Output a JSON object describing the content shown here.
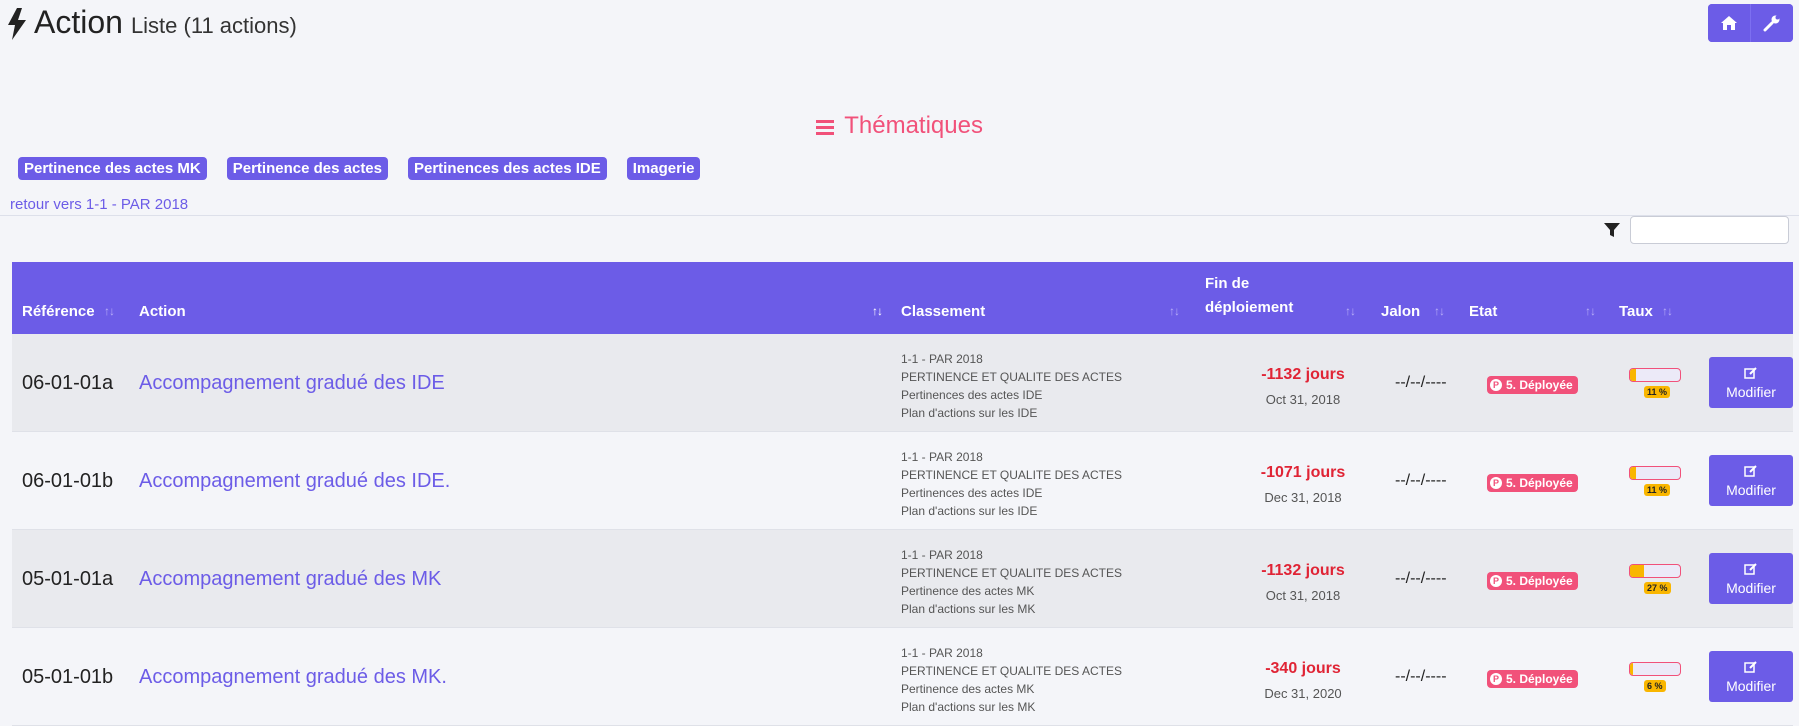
{
  "header": {
    "title": "Action",
    "subtitle": "Liste (11 actions)",
    "icon": "bolt-icon"
  },
  "toolbar": {
    "home_icon": "home-icon",
    "settings_icon": "wrench-icon"
  },
  "thematiques": {
    "title": "Thématiques",
    "tags": [
      "Pertinence des actes MK",
      "Pertinence des actes",
      "Pertinences des actes IDE",
      "Imagerie"
    ]
  },
  "back_link": "retour vers 1-1 - PAR 2018",
  "search": {
    "value": "",
    "placeholder": ""
  },
  "table": {
    "columns": {
      "reference": "Référence",
      "action": "Action",
      "classement": "Classement",
      "fin_line1": "Fin de",
      "fin_line2": "déploiement",
      "jalon": "Jalon",
      "etat": "Etat",
      "taux": "Taux"
    },
    "edit_label": "Modifier",
    "rows": [
      {
        "ref": "06-01-01a",
        "action": "Accompagnement gradué des IDE",
        "classement": [
          "1-1 - PAR 2018",
          "PERTINENCE ET QUALITE DES ACTES",
          "Pertinences des actes IDE",
          "Plan d'actions sur les IDE"
        ],
        "days": "-1132 jours",
        "date": "Oct 31, 2018",
        "jalon": "--/--/----",
        "etat": "5. Déployée",
        "taux": 11,
        "taux_label": "11 %"
      },
      {
        "ref": "06-01-01b",
        "action": "Accompagnement gradué des IDE.",
        "classement": [
          "1-1 - PAR 2018",
          "PERTINENCE ET QUALITE DES ACTES",
          "Pertinences des actes IDE",
          "Plan d'actions sur les IDE"
        ],
        "days": "-1071 jours",
        "date": "Dec 31, 2018",
        "jalon": "--/--/----",
        "etat": "5. Déployée",
        "taux": 11,
        "taux_label": "11 %"
      },
      {
        "ref": "05-01-01a",
        "action": "Accompagnement gradué des MK",
        "classement": [
          "1-1 - PAR 2018",
          "PERTINENCE ET QUALITE DES ACTES",
          "Pertinence des actes MK",
          "Plan d'actions sur les MK"
        ],
        "days": "-1132 jours",
        "date": "Oct 31, 2018",
        "jalon": "--/--/----",
        "etat": "5. Déployée",
        "taux": 27,
        "taux_label": "27 %"
      },
      {
        "ref": "05-01-01b",
        "action": "Accompagnement gradué des MK.",
        "classement": [
          "1-1 - PAR 2018",
          "PERTINENCE ET QUALITE DES ACTES",
          "Pertinence des actes MK",
          "Plan d'actions sur les MK"
        ],
        "days": "-340 jours",
        "date": "Dec 31, 2020",
        "jalon": "--/--/----",
        "etat": "5. Déployée",
        "taux": 6,
        "taux_label": "6 %"
      }
    ]
  },
  "colors": {
    "accent": "#6c5ce7",
    "pink": "#f1517a",
    "danger": "#e02435",
    "warning": "#f9b600"
  }
}
